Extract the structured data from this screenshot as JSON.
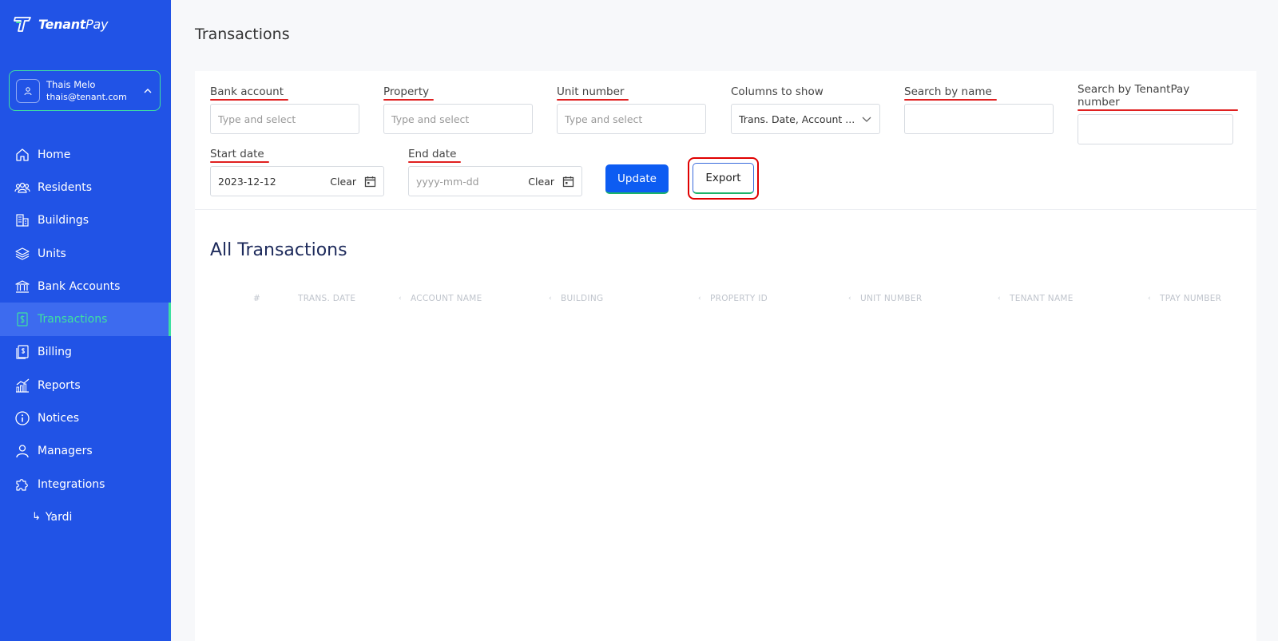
{
  "app": {
    "logo_text_bold": "Tenant",
    "logo_text_light": "Pay",
    "brand_color": "#2153e6",
    "accent_color": "#3ee0a0"
  },
  "user": {
    "name": "Thais Melo",
    "email": "thais@tenant.com"
  },
  "sidebar": {
    "items": [
      {
        "label": "Home",
        "icon": "home-icon"
      },
      {
        "label": "Residents",
        "icon": "residents-icon"
      },
      {
        "label": "Buildings",
        "icon": "buildings-icon"
      },
      {
        "label": "Units",
        "icon": "layers-icon"
      },
      {
        "label": "Bank Accounts",
        "icon": "bank-icon"
      },
      {
        "label": "Transactions",
        "icon": "transactions-icon",
        "active": true
      },
      {
        "label": "Billing",
        "icon": "billing-icon"
      },
      {
        "label": "Reports",
        "icon": "reports-icon"
      },
      {
        "label": "Notices",
        "icon": "info-icon"
      },
      {
        "label": "Managers",
        "icon": "user-icon"
      },
      {
        "label": "Integrations",
        "icon": "puzzle-icon"
      }
    ],
    "sub_items": [
      {
        "label": "Yardi",
        "arrow": "↳"
      }
    ]
  },
  "page": {
    "title": "Transactions"
  },
  "filters": {
    "bank_account": {
      "label": "Bank account",
      "placeholder": "Type and select"
    },
    "property": {
      "label": "Property",
      "placeholder": "Type and select"
    },
    "unit_number": {
      "label": "Unit number",
      "placeholder": "Type and select"
    },
    "columns_to_show": {
      "label": "Columns to show",
      "value": "Trans. Date, Account ..."
    },
    "search_name": {
      "label": "Search by name",
      "value": ""
    },
    "search_tpay": {
      "label": "Search by TenantPay number",
      "value": ""
    },
    "start_date": {
      "label": "Start date",
      "value": "2023-12-12",
      "clear_label": "Clear"
    },
    "end_date": {
      "label": "End date",
      "placeholder": "yyyy-mm-dd",
      "clear_label": "Clear"
    },
    "update_label": "Update",
    "export_label": "Export"
  },
  "table": {
    "title": "All Transactions",
    "columns": [
      "#",
      "TRANS. DATE",
      "ACCOUNT NAME",
      "BUILDING",
      "PROPERTY ID",
      "UNIT NUMBER",
      "TENANT NAME",
      "TPAY NUMBER"
    ],
    "rows": []
  }
}
